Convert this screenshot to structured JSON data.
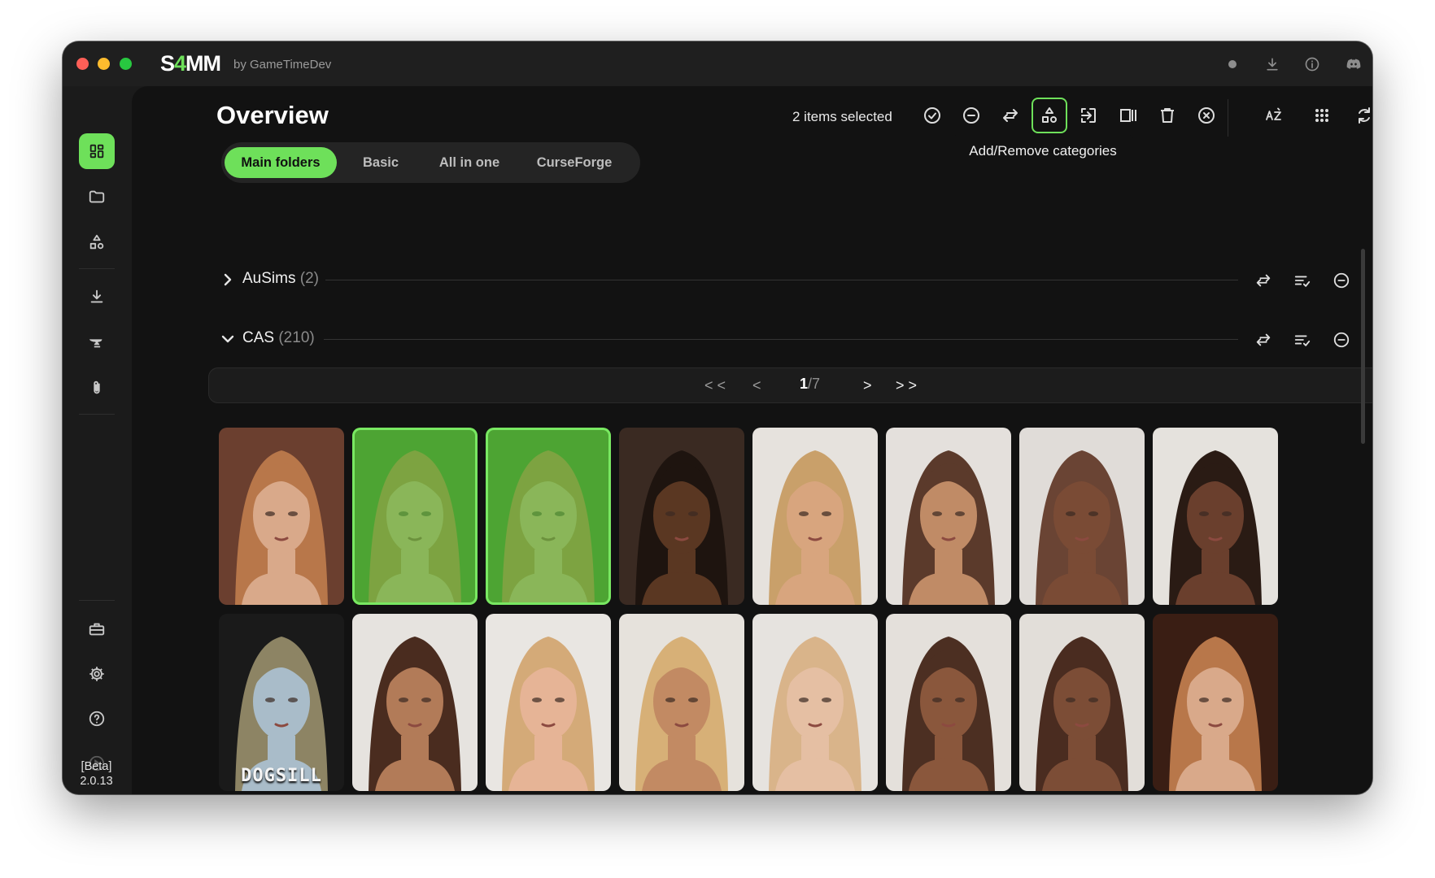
{
  "app": {
    "brand_prefix": "S",
    "brand_four": "4",
    "brand_suffix": "MM",
    "by_line": "by GameTimeDev"
  },
  "sidebar": {
    "items": [
      {
        "icon": "dashboard-icon",
        "label": "Overview",
        "active": true
      },
      {
        "icon": "folder-icon",
        "label": "Folders"
      },
      {
        "icon": "categories-icon",
        "label": "Categories"
      },
      {
        "icon": "download-icon",
        "label": "Downloads"
      },
      {
        "icon": "anvil-icon",
        "label": "Tools"
      },
      {
        "icon": "paperclip-icon",
        "label": "Attachments"
      },
      {
        "icon": "toolbox-icon",
        "label": "Toolbox"
      },
      {
        "icon": "gear-icon",
        "label": "Settings"
      },
      {
        "icon": "help-icon",
        "label": "Help"
      },
      {
        "icon": "play-icon",
        "label": "Play"
      }
    ],
    "version_line1": "[Beta]",
    "version_line2": "2.0.13"
  },
  "header": {
    "title": "Overview",
    "selection_text": "2 items selected",
    "toolbar": [
      {
        "icon": "check-circle-icon"
      },
      {
        "icon": "minus-circle-icon"
      },
      {
        "icon": "swap-arrows-icon"
      },
      {
        "icon": "categories-icon",
        "active": true
      },
      {
        "icon": "move-into-icon"
      },
      {
        "icon": "columns-icon"
      },
      {
        "icon": "trash-icon"
      },
      {
        "icon": "x-circle-icon"
      },
      {
        "icon": "sort-az-icon"
      },
      {
        "icon": "grid-dots-icon"
      },
      {
        "icon": "refresh-icon"
      },
      {
        "icon": "filter-icon"
      }
    ],
    "tooltip": "Add/Remove categories"
  },
  "tabs": [
    {
      "label": "Main folders",
      "active": true
    },
    {
      "label": "Basic"
    },
    {
      "label": "All in one"
    },
    {
      "label": "CurseForge"
    }
  ],
  "groups": [
    {
      "name": "AuSims",
      "count": "(2)",
      "expanded": false
    },
    {
      "name": "CAS",
      "count": "(210)",
      "expanded": true
    }
  ],
  "pager": {
    "first": "< <",
    "prev": "<",
    "current": "1",
    "total": "/7",
    "next": ">",
    "last": "> >"
  },
  "cards": [
    {
      "selected": false,
      "bg": "#6b3f2f",
      "skin": "#d9a98a",
      "hair": "#b8774a",
      "label": ""
    },
    {
      "selected": true,
      "bg": "#3c7a26",
      "skin": "#d9a98a",
      "hair": "#b8774a",
      "label": ""
    },
    {
      "selected": true,
      "bg": "#3c7a26",
      "skin": "#d9a98a",
      "hair": "#b8774a",
      "label": ""
    },
    {
      "selected": false,
      "bg": "#3a2a22",
      "skin": "#5a3722",
      "hair": "#1e140f",
      "label": ""
    },
    {
      "selected": false,
      "bg": "#e6e2dd",
      "skin": "#d8a57e",
      "hair": "#c9a06a",
      "label": ""
    },
    {
      "selected": false,
      "bg": "#e4e0dc",
      "skin": "#c08b66",
      "hair": "#5b3a2b",
      "label": ""
    },
    {
      "selected": false,
      "bg": "#e0dcd8",
      "skin": "#7a4b35",
      "hair": "#6a4434",
      "label": ""
    },
    {
      "selected": false,
      "bg": "#e5e2dd",
      "skin": "#6a3f2d",
      "hair": "#2a1b14",
      "label": ""
    },
    {
      "selected": false,
      "bg": "#1a1a1a",
      "skin": "#a9bcc9",
      "hair": "#8d8464",
      "label": "DOGSILL"
    },
    {
      "selected": false,
      "bg": "#e6e3df",
      "skin": "#b27b58",
      "hair": "#4a2c1f",
      "label": ""
    },
    {
      "selected": false,
      "bg": "#e9e6e2",
      "skin": "#e6b496",
      "hair": "#d4aa78",
      "label": ""
    },
    {
      "selected": false,
      "bg": "#e6e2dc",
      "skin": "#c28a63",
      "hair": "#d7b077",
      "label": ""
    },
    {
      "selected": false,
      "bg": "#e6e3df",
      "skin": "#e5bfa3",
      "hair": "#d9b48a",
      "label": ""
    },
    {
      "selected": false,
      "bg": "#e4e0db",
      "skin": "#8a573c",
      "hair": "#4c2f22",
      "label": ""
    },
    {
      "selected": false,
      "bg": "#e2ded9",
      "skin": "#7c4d36",
      "hair": "#4a2c20",
      "label": ""
    },
    {
      "selected": false,
      "bg": "#3a1e14",
      "skin": "#d9a98a",
      "hair": "#b8774a",
      "label": ""
    }
  ],
  "colors": {
    "accent": "#6ee05a",
    "window_bg": "#1b1b1b",
    "main_bg": "#121212"
  }
}
